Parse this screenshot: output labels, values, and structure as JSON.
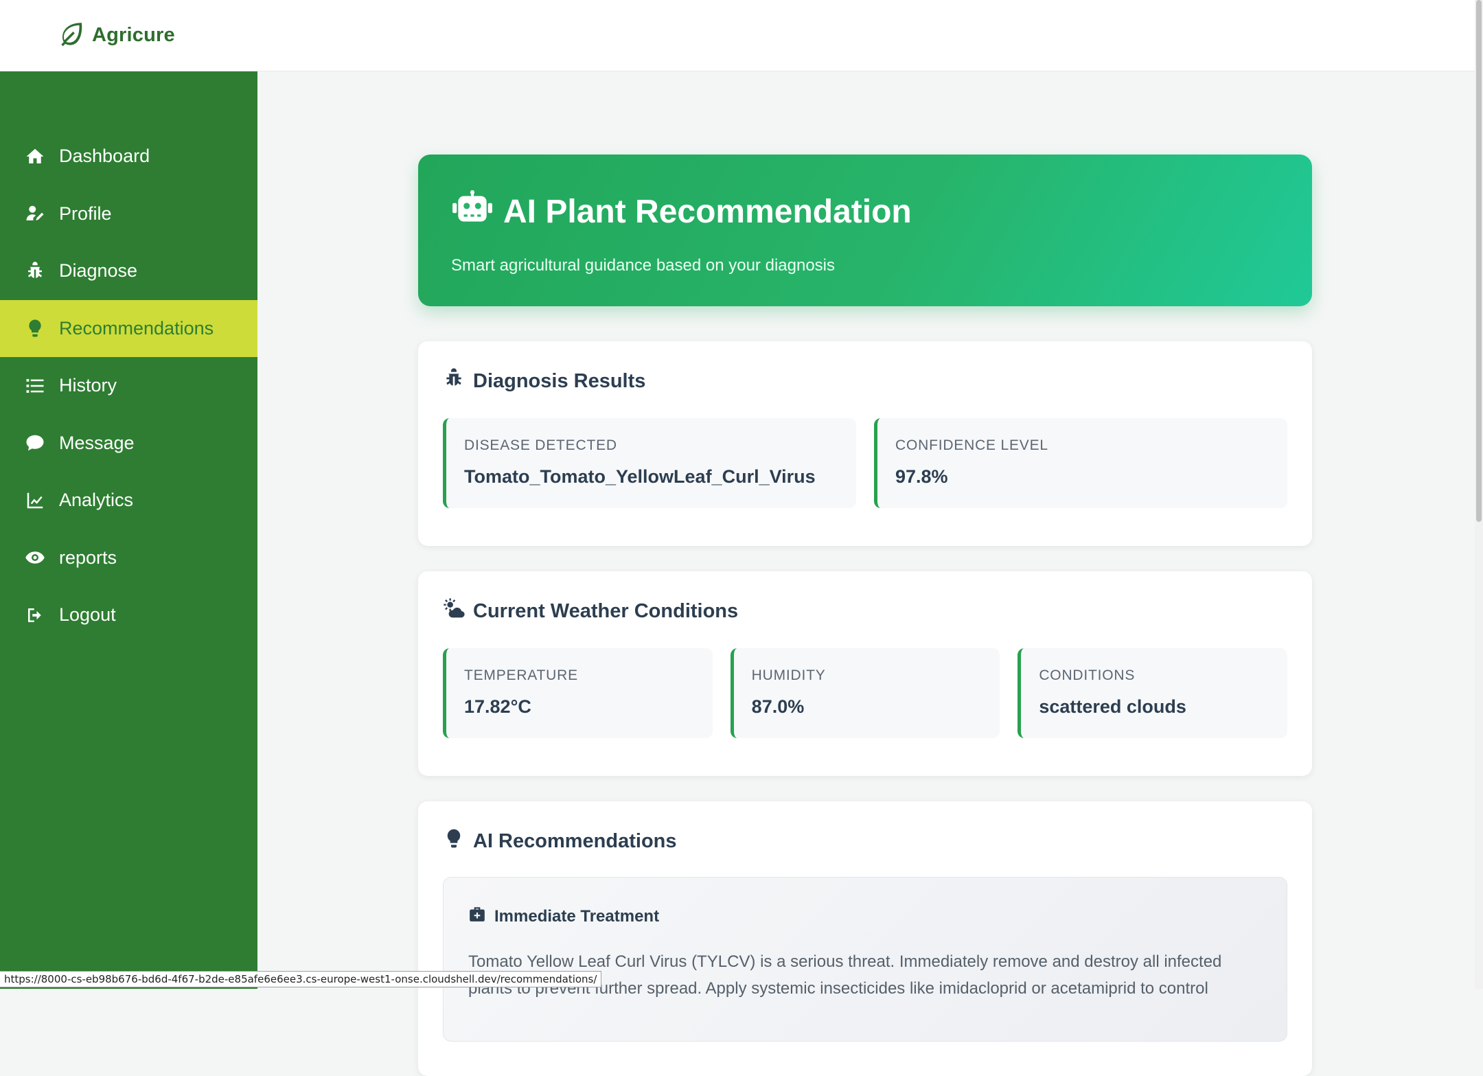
{
  "app": {
    "name": "Agricure"
  },
  "sidebar": {
    "items": [
      {
        "label": "Dashboard",
        "icon": "home-icon",
        "active": false
      },
      {
        "label": "Profile",
        "icon": "user-edit-icon",
        "active": false
      },
      {
        "label": "Diagnose",
        "icon": "bug-icon",
        "active": false
      },
      {
        "label": "Recommendations",
        "icon": "lightbulb-icon",
        "active": true
      },
      {
        "label": "History",
        "icon": "list-icon",
        "active": false
      },
      {
        "label": "Message",
        "icon": "comment-icon",
        "active": false
      },
      {
        "label": "Analytics",
        "icon": "line-chart-icon",
        "active": false
      },
      {
        "label": "reports",
        "icon": "eye-icon",
        "active": false
      },
      {
        "label": "Logout",
        "icon": "logout-icon",
        "active": false
      }
    ]
  },
  "hero": {
    "title": "AI Plant Recommendation",
    "subtitle": "Smart agricultural guidance based on your diagnosis"
  },
  "diagnosis": {
    "title": "Diagnosis Results",
    "disease_label": "DISEASE DETECTED",
    "disease_value": "Tomato_Tomato_YellowLeaf_Curl_Virus",
    "confidence_label": "CONFIDENCE LEVEL",
    "confidence_value": "97.8%"
  },
  "weather": {
    "title": "Current Weather Conditions",
    "temperature_label": "TEMPERATURE",
    "temperature_value": "17.82°C",
    "humidity_label": "HUMIDITY",
    "humidity_value": "87.0%",
    "conditions_label": "CONDITIONS",
    "conditions_value": "scattered clouds"
  },
  "recommendations": {
    "title": "AI Recommendations",
    "treatment_title": "Immediate Treatment",
    "treatment_text": "Tomato Yellow Leaf Curl Virus (TYLCV) is a serious threat. Immediately remove and destroy all infected plants to prevent further spread. Apply systemic insecticides like imidacloprid or acetamiprid to control"
  },
  "status_bar": {
    "url": "https://8000-cs-eb98b676-bd6d-4f67-b2de-e85afe6e6ee3.cs-europe-west1-onse.cloudshell.dev/recommendations/"
  },
  "colors": {
    "sidebar": "#2e7d32",
    "active": "#cddc39",
    "accent": "#27a14f",
    "hero_start": "#22a65a",
    "hero_end": "#20c997"
  }
}
